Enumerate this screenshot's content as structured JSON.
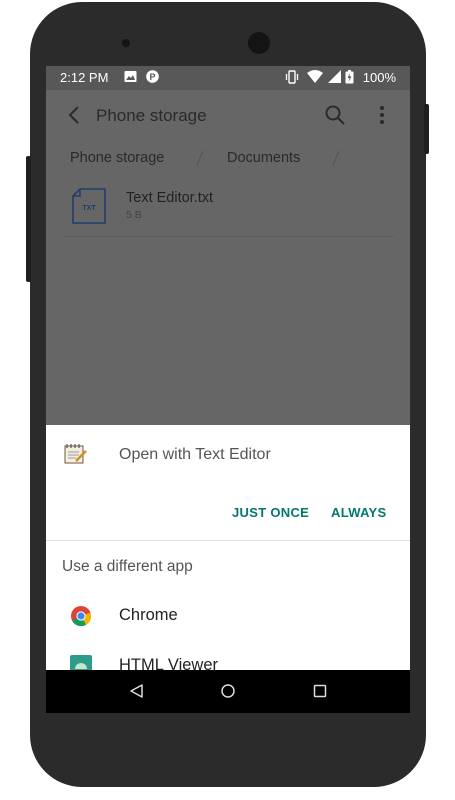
{
  "status_bar": {
    "time": "2:12 PM",
    "icons": [
      "image-icon",
      "parking-icon",
      "vibrate-icon",
      "wifi-icon",
      "signal-icon",
      "battery-icon"
    ],
    "battery": "100%"
  },
  "app_bar": {
    "title": "Phone storage",
    "icons": [
      "back-arrow-icon",
      "search-icon",
      "more-vert-icon"
    ]
  },
  "breadcrumbs": [
    "Phone storage",
    "Documents"
  ],
  "file": {
    "name": "Text Editor.txt",
    "size": "5 B",
    "icon_label": "TXT"
  },
  "chooser": {
    "title": "Open with Text Editor",
    "just_once": "JUST ONCE",
    "always": "ALWAYS",
    "different_app": "Use a different app",
    "apps": [
      {
        "name": "Chrome",
        "icon": "chrome-icon"
      },
      {
        "name": "HTML Viewer",
        "icon": "android-icon"
      }
    ],
    "accent_color": "#00796b"
  },
  "nav_bar": {
    "icons": [
      "nav-back-icon",
      "nav-home-icon",
      "nav-recents-icon"
    ]
  }
}
